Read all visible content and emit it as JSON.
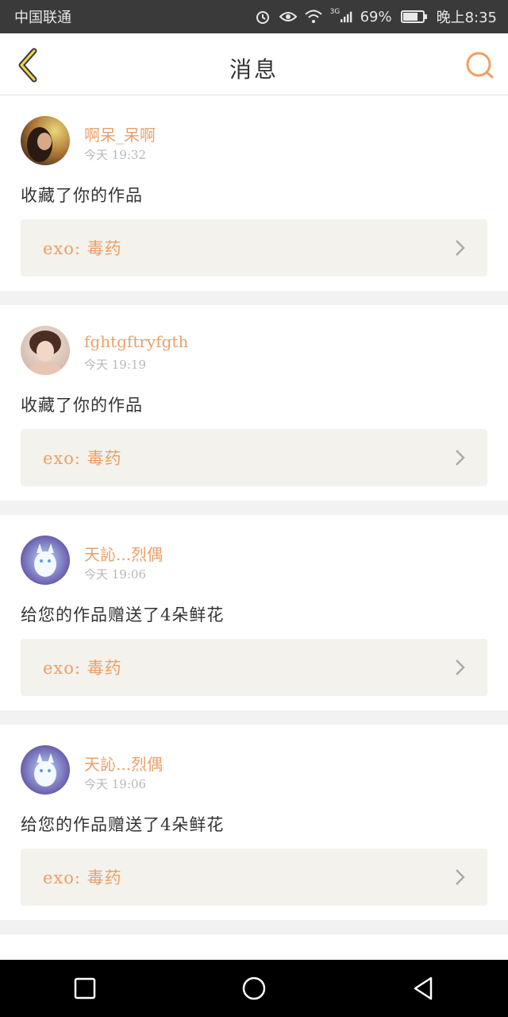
{
  "status_bar": {
    "carrier": "中国联通",
    "signal_label": "3G",
    "battery": "69%",
    "time": "晚上8:35",
    "icons": [
      "alarm-icon",
      "eye-icon",
      "wifi-icon",
      "signal-icon",
      "battery-icon"
    ]
  },
  "header": {
    "title": "消息",
    "back_icon": "chevron-left-icon",
    "search_icon": "search-icon"
  },
  "notifications": [
    {
      "username": "啊呆_呆啊",
      "time": "今天 19:32",
      "message": "收藏了你的作品",
      "work": "exo: 毒药"
    },
    {
      "username": "fghtgftryfgth",
      "time": "今天 19:19",
      "message": "收藏了你的作品",
      "work": "exo: 毒药"
    },
    {
      "username": "天訫...烈偶",
      "time": "今天 19:06",
      "message": "给您的作品赠送了4朵鲜花",
      "work": "exo: 毒药"
    },
    {
      "username": "天訫...烈偶",
      "time": "今天 19:06",
      "message": "给您的作品赠送了4朵鲜花",
      "work": "exo: 毒药"
    }
  ],
  "colors": {
    "accent": "#e9a06a",
    "background": "#f2f2f2",
    "link_bg": "#f4f2ec",
    "status_bar": "#3a3a3a"
  },
  "nav_bar": {
    "icons": [
      "recent-apps-icon",
      "home-icon",
      "back-triangle-icon"
    ]
  }
}
